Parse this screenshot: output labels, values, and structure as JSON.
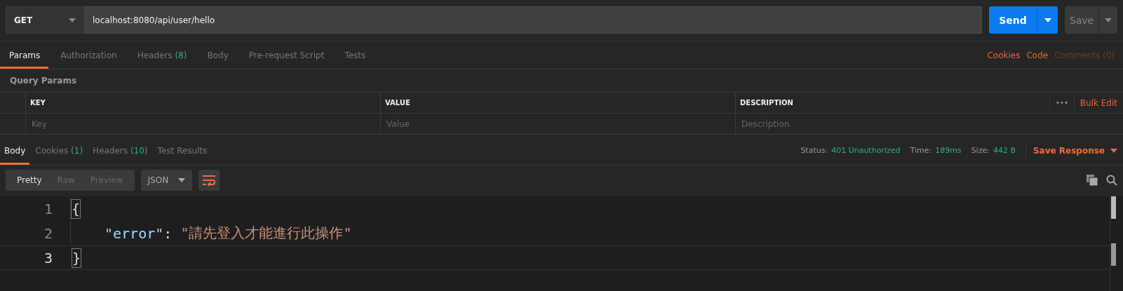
{
  "request_bar": {
    "method": "GET",
    "url": "localhost:8080/api/user/hello",
    "send_label": "Send",
    "save_label": "Save"
  },
  "request_tabs": [
    {
      "label": "Params",
      "selected": true
    },
    {
      "label": "Authorization",
      "selected": false
    },
    {
      "label": "Headers",
      "count": "(8)",
      "selected": false
    },
    {
      "label": "Body",
      "selected": false
    },
    {
      "label": "Pre-request Script",
      "selected": false
    },
    {
      "label": "Tests",
      "selected": false
    }
  ],
  "request_links": [
    {
      "label": "Cookies",
      "disabled": false
    },
    {
      "label": "Code",
      "disabled": false
    },
    {
      "label": "Comments (0)",
      "disabled": true
    }
  ],
  "query_params": {
    "title": "Query Params",
    "columns": [
      "KEY",
      "VALUE",
      "DESCRIPTION"
    ],
    "placeholders": [
      "Key",
      "Value",
      "Description"
    ],
    "more_label": "•••",
    "bulk_edit_label": "Bulk Edit"
  },
  "response_tabs": [
    {
      "label": "Body",
      "selected": true
    },
    {
      "label": "Cookies",
      "count": "(1)",
      "selected": false
    },
    {
      "label": "Headers",
      "count": "(10)",
      "selected": false
    },
    {
      "label": "Test Results",
      "selected": false
    }
  ],
  "response_meta": [
    {
      "label": "Status:",
      "value": "401 Unauthorized"
    },
    {
      "label": "Time:",
      "value": "189ms"
    },
    {
      "label": "Size:",
      "value": "442 B"
    }
  ],
  "save_response_label": "Save Response",
  "view_modes": [
    {
      "label": "Pretty",
      "selected": true
    },
    {
      "label": "Raw",
      "selected": false
    },
    {
      "label": "Preview",
      "selected": false
    }
  ],
  "format": "JSON",
  "code_lines": [
    {
      "number": "1",
      "active": false,
      "tokens": [
        {
          "kind": "bracket",
          "text": "{"
        }
      ]
    },
    {
      "number": "2",
      "active": false,
      "tokens": [
        {
          "kind": "key",
          "text": "\"error\""
        },
        {
          "kind": "punct",
          "text": ": "
        },
        {
          "kind": "string",
          "text": "\"請先登入才能進行此操作\""
        }
      ]
    },
    {
      "number": "3",
      "active": true,
      "tokens": [
        {
          "kind": "bracket",
          "text": "}"
        }
      ]
    }
  ]
}
